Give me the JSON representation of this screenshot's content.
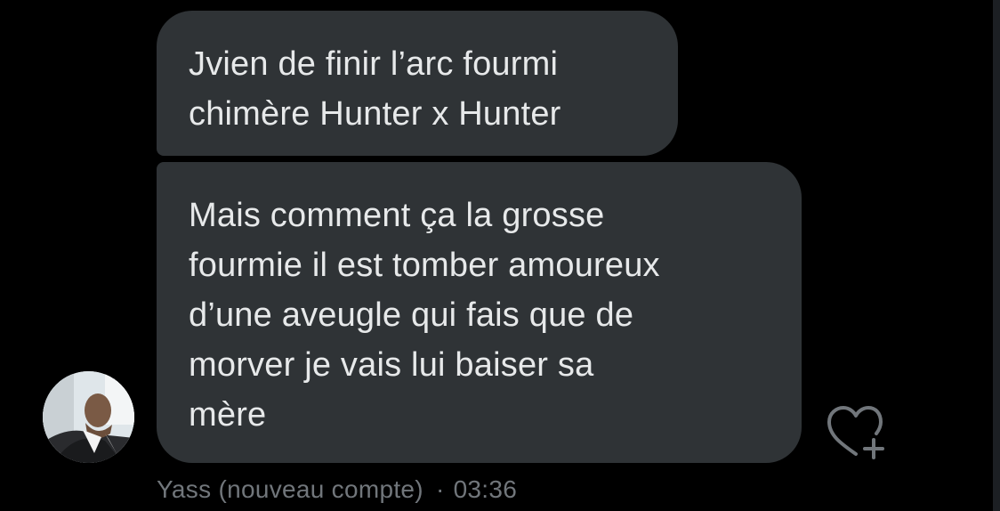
{
  "messages": [
    {
      "text": "Jvien de finir l’arc fourmi\nchimère Hunter x Hunter"
    },
    {
      "text": "Mais comment ça la grosse\nfourmie il est tomber amoureux\nd’une aveugle qui fais que de\nmorver je vais lui baiser sa\nmère"
    }
  ],
  "sender": {
    "name": "Yass (nouveau compte)",
    "separator": "·",
    "time": "03:36"
  },
  "icons": {
    "like": "heart-plus-icon",
    "avatar": "user-avatar"
  },
  "colors": {
    "background": "#000000",
    "bubble": "#2f3336",
    "text": "#e7e9ea",
    "meta": "#71767b"
  }
}
